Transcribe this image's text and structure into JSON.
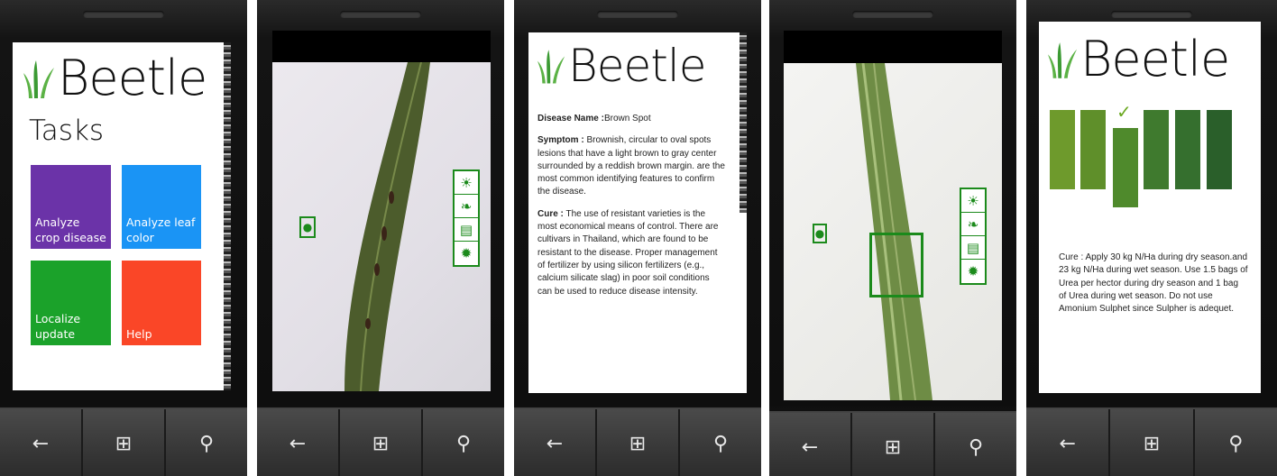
{
  "app": {
    "name": "Beetle"
  },
  "screen1": {
    "title": "Tasks",
    "tiles": [
      {
        "label": "Analyze crop disease",
        "color": "#6b33a8"
      },
      {
        "label": "Analyze leaf color",
        "color": "#1a94f5"
      },
      {
        "label": "Localize update",
        "color": "#1ba22a"
      },
      {
        "label": "Help",
        "color": "#fa4627"
      }
    ]
  },
  "screen2": {
    "icons": [
      "sun-leaf-icon",
      "leaf-icon",
      "landscape-icon",
      "sun-icon"
    ]
  },
  "screen3": {
    "disease_label": "Disease Name :",
    "disease_value": "Brown Spot",
    "symptom_label": "Symptom :",
    "symptom_text": "Brownish, circular to oval spots lesions that have a light brown to gray center surrounded by a reddish brown margin. are the most common identifying features to confirm the disease.",
    "cure_label": "Cure :",
    "cure_text": "The use of resistant varieties is the most economical means of control. There are cultivars in Thailand, which are found to be resistant to the disease. Proper management of fertilizer by using silicon fertilizers (e.g., calcium silicate slag) in poor soil conditions can be used to reduce disease intensity."
  },
  "screen5": {
    "selected_index": 2,
    "leaf_colors": [
      "#6e9a2c",
      "#5f8f2a",
      "#4f8a2c",
      "#3f7a2e",
      "#356f2e",
      "#2a5f2a"
    ],
    "cure_text": "Cure : Apply 30 kg N/Ha during dry season.and 23 kg N/Ha during wet season. Use 1.5 bags of Urea per hector during dry season and 1 bag of Urea during wet season. Do not use Amonium Sulphet since Sulpher is adequet."
  },
  "nav": {
    "back": "←",
    "home": "⊞",
    "search": "⚲"
  }
}
